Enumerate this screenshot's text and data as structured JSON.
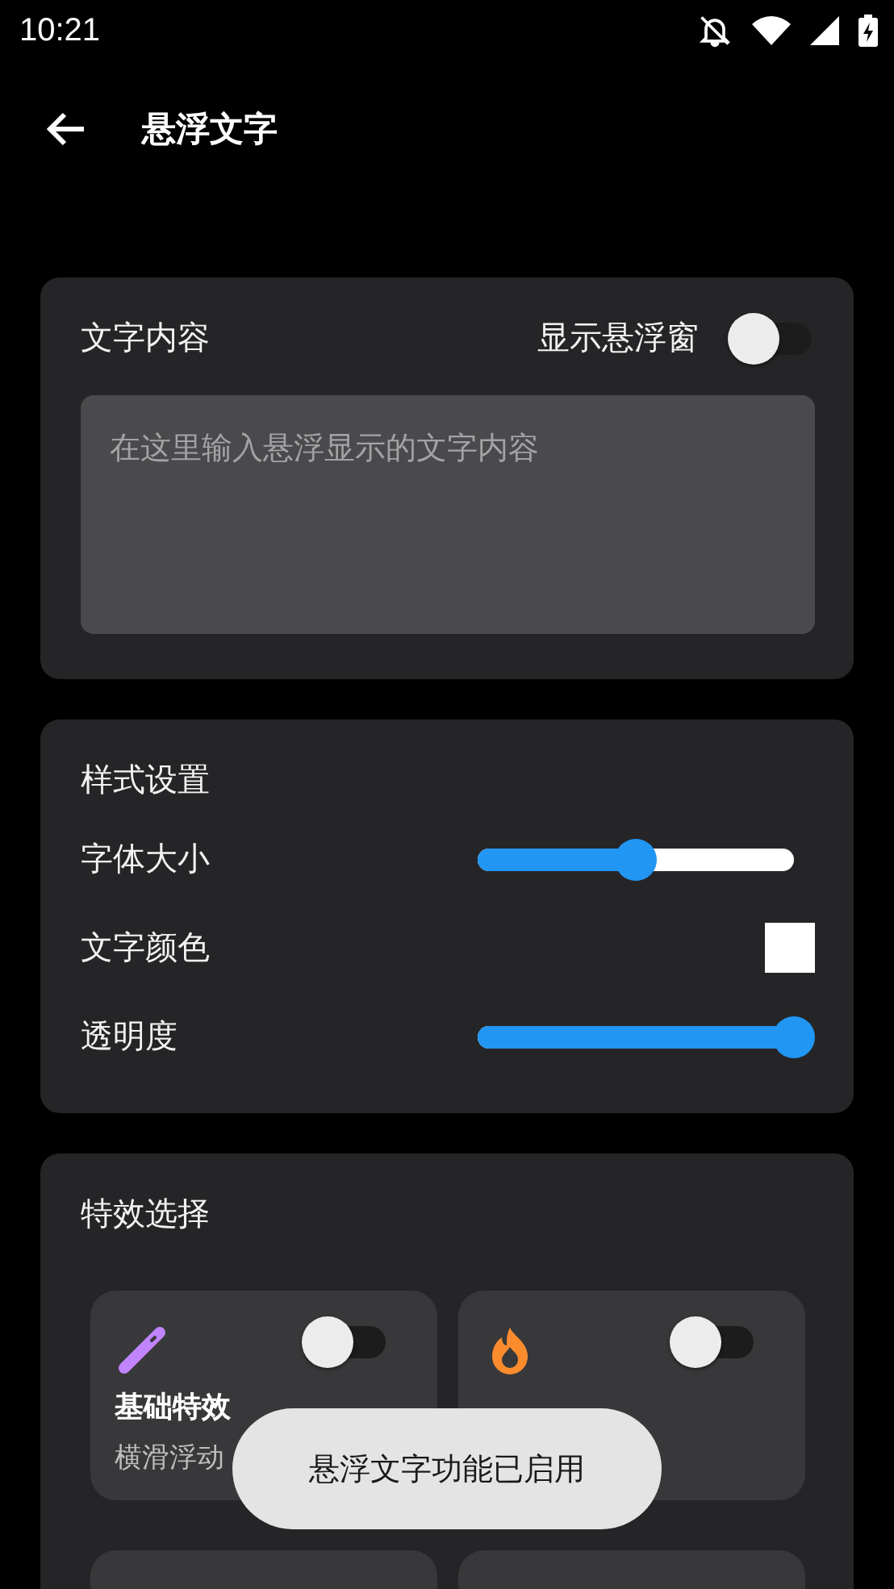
{
  "status_bar": {
    "time": "10:21"
  },
  "app_bar": {
    "title": "悬浮文字"
  },
  "content_card": {
    "title": "文字内容",
    "toggle_label": "显示悬浮窗",
    "toggle_on": false,
    "input": {
      "placeholder": "在这里输入悬浮显示的文字内容"
    }
  },
  "style_card": {
    "title": "样式设置",
    "rows": [
      {
        "kind": "slider",
        "label": "字体大小",
        "level": 0.5
      },
      {
        "kind": "color",
        "label": "文字颜色",
        "color": "#ffffff"
      },
      {
        "kind": "slider",
        "label": "透明度",
        "level": 1
      }
    ]
  },
  "effects_card": {
    "title": "特效选择",
    "effects": [
      {
        "kind": "wand",
        "title": "基础特效",
        "description": "横滑浮动",
        "on": false
      },
      {
        "kind": "flame",
        "on": false
      }
    ]
  },
  "toast": "悬浮文字功能已启用"
}
